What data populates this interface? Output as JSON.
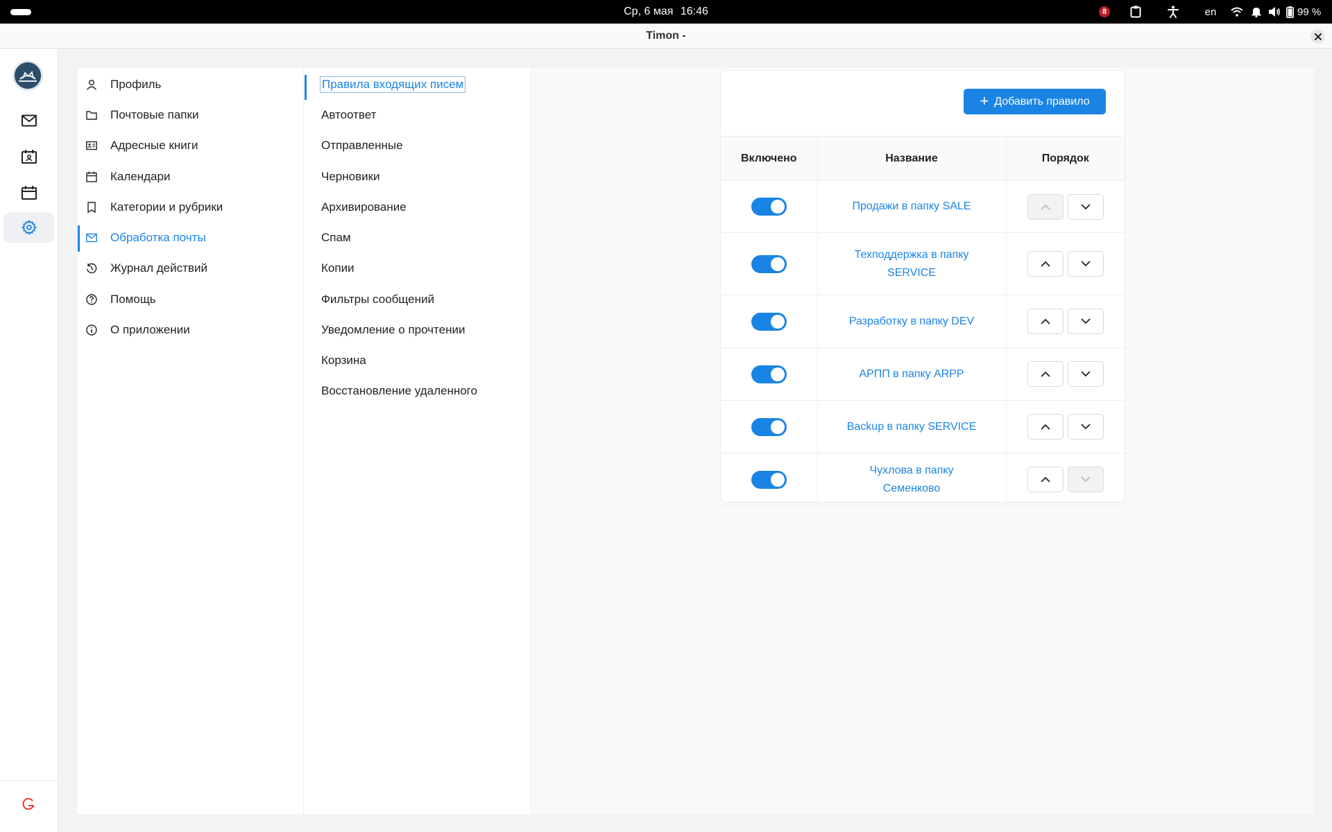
{
  "system_bar": {
    "date": "Ср, 6 мая",
    "time": "16:46",
    "notification_count": "8",
    "keyboard_layout": "en",
    "battery": "99 %"
  },
  "window": {
    "title": "Timon -"
  },
  "app_rail": {
    "items": [
      {
        "icon": "mail-icon",
        "active": false
      },
      {
        "icon": "contacts-icon",
        "active": false
      },
      {
        "icon": "calendar-icon",
        "active": false
      },
      {
        "icon": "gear-icon",
        "active": true
      }
    ]
  },
  "settings_nav": {
    "items": [
      {
        "label": "Профиль",
        "icon": "user-icon"
      },
      {
        "label": "Почтовые папки",
        "icon": "folder-icon"
      },
      {
        "label": "Адресные книги",
        "icon": "address-book-icon"
      },
      {
        "label": "Календари",
        "icon": "calendar-icon"
      },
      {
        "label": "Категории и рубрики",
        "icon": "bookmark-icon"
      },
      {
        "label": "Обработка почты",
        "icon": "mail-icon",
        "active": true
      },
      {
        "label": "Журнал действий",
        "icon": "history-icon"
      },
      {
        "label": "Помощь",
        "icon": "help-icon"
      },
      {
        "label": "О приложении",
        "icon": "info-icon"
      }
    ]
  },
  "mail_processing_nav": {
    "items": [
      {
        "label": "Правила входящих писем",
        "active": true
      },
      {
        "label": "Автоответ"
      },
      {
        "label": "Отправленные"
      },
      {
        "label": "Черновики"
      },
      {
        "label": "Архивирование"
      },
      {
        "label": "Спам"
      },
      {
        "label": "Копии"
      },
      {
        "label": "Фильтры сообщений"
      },
      {
        "label": "Уведомление о прочтении"
      },
      {
        "label": "Корзина"
      },
      {
        "label": "Восстановление удаленного"
      }
    ]
  },
  "rules": {
    "add_button_label": "Добавить правило",
    "columns": {
      "enabled": "Включено",
      "name": "Название",
      "order": "Порядок"
    },
    "rows": [
      {
        "name": "Продажи в папку SALE",
        "enabled": true,
        "up_disabled": true,
        "down_disabled": false
      },
      {
        "name": "Техподдержка в папку SERVICE",
        "enabled": true,
        "up_disabled": false,
        "down_disabled": false
      },
      {
        "name": "Разработку в папку DEV",
        "enabled": true,
        "up_disabled": false,
        "down_disabled": false
      },
      {
        "name": "АРПП в папку ARPP",
        "enabled": true,
        "up_disabled": false,
        "down_disabled": false
      },
      {
        "name": "Backup в папку SERVICE",
        "enabled": true,
        "up_disabled": false,
        "down_disabled": false
      },
      {
        "name": "Чухлова в папку Семенково",
        "enabled": true,
        "up_disabled": false,
        "down_disabled": true
      }
    ]
  },
  "colors": {
    "accent": "#1a84e4",
    "brand_red": "#e53935"
  }
}
